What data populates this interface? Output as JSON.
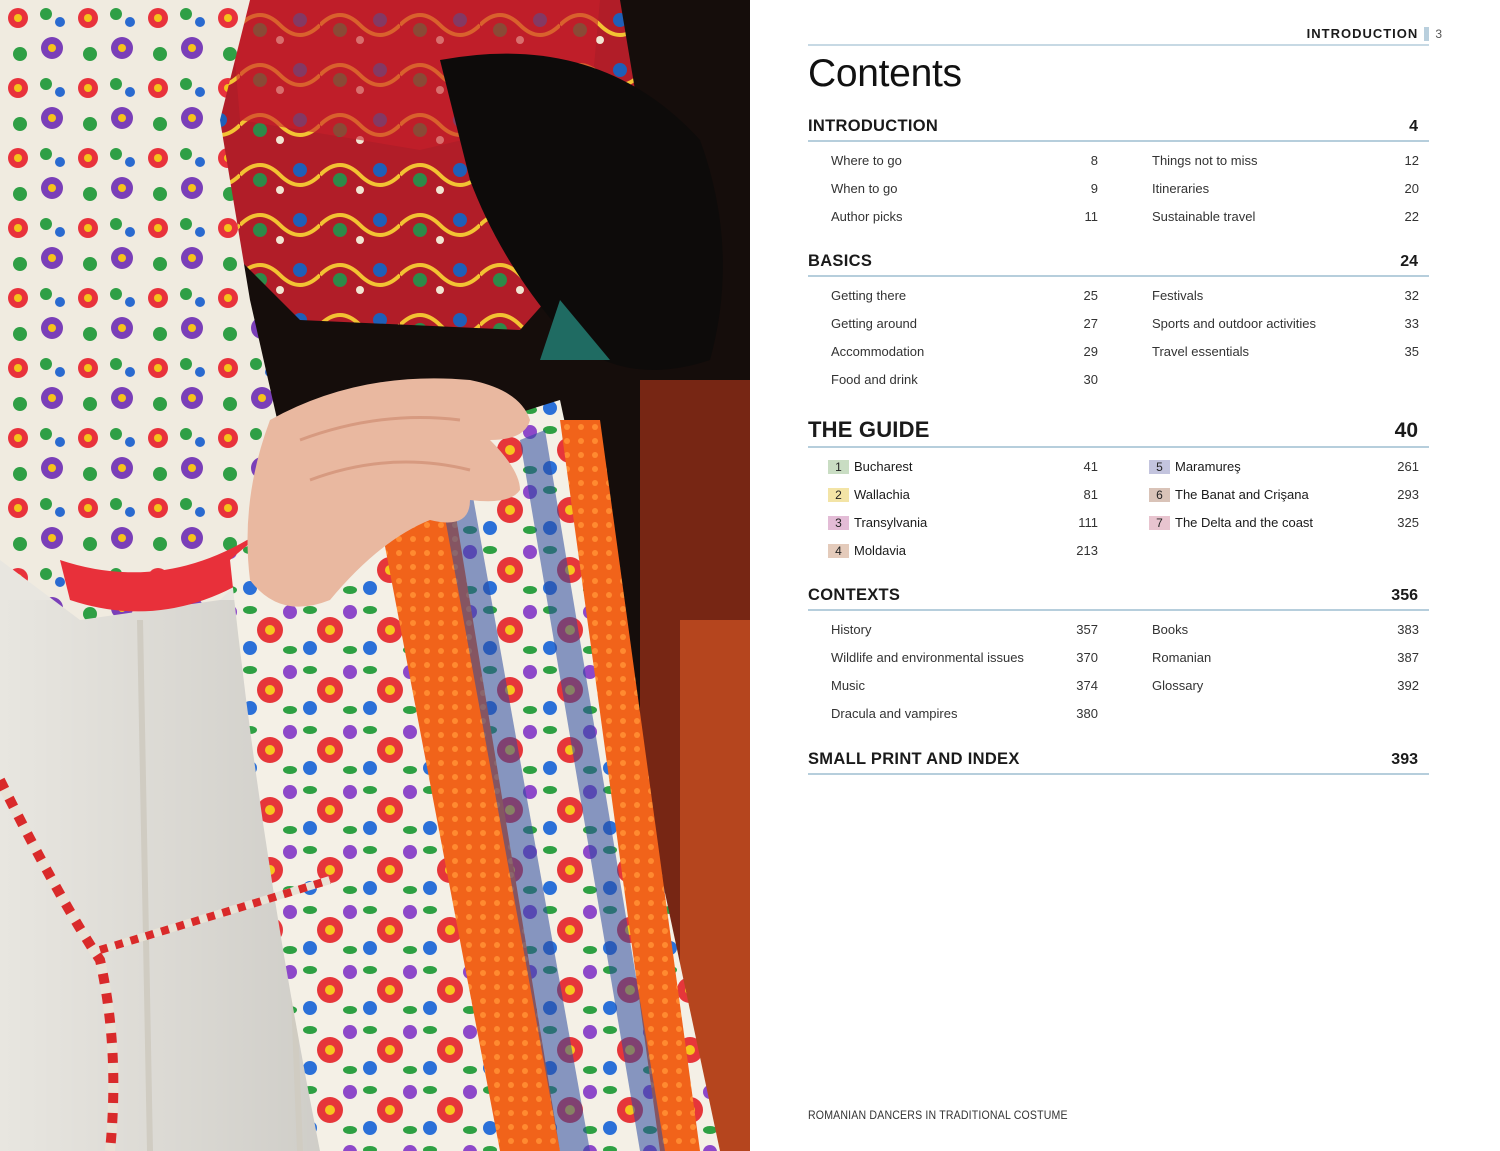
{
  "running_head": {
    "label": "INTRODUCTION",
    "page_number": "3"
  },
  "title": "Contents",
  "sections": {
    "introduction": {
      "title": "INTRODUCTION",
      "page": "4",
      "left": [
        {
          "label": "Where to go",
          "page": "8"
        },
        {
          "label": "When to go",
          "page": "9"
        },
        {
          "label": "Author picks",
          "page": "11"
        }
      ],
      "right": [
        {
          "label": "Things not to miss",
          "page": "12"
        },
        {
          "label": "Itineraries",
          "page": "20"
        },
        {
          "label": "Sustainable travel",
          "page": "22"
        }
      ]
    },
    "basics": {
      "title": "BASICS",
      "page": "24",
      "left": [
        {
          "label": "Getting there",
          "page": "25"
        },
        {
          "label": "Getting around",
          "page": "27"
        },
        {
          "label": "Accommodation",
          "page": "29"
        },
        {
          "label": "Food and drink",
          "page": "30"
        }
      ],
      "right": [
        {
          "label": "Festivals",
          "page": "32"
        },
        {
          "label": "Sports and outdoor activities",
          "page": "33"
        },
        {
          "label": "Travel essentials",
          "page": "35"
        }
      ]
    },
    "guide": {
      "title": "THE GUIDE",
      "page": "40",
      "left": [
        {
          "num": "1",
          "label": "Bucharest",
          "page": "41",
          "color": "#c9ddc3"
        },
        {
          "num": "2",
          "label": "Wallachia",
          "page": "81",
          "color": "#f3e4a6"
        },
        {
          "num": "3",
          "label": "Transylvania",
          "page": "111",
          "color": "#e3bcd6"
        },
        {
          "num": "4",
          "label": "Moldavia",
          "page": "213",
          "color": "#e4cbbb"
        }
      ],
      "right": [
        {
          "num": "5",
          "label": "Maramureş",
          "page": "261",
          "color": "#c3c4de"
        },
        {
          "num": "6",
          "label": "The Banat and Crişana",
          "page": "293",
          "color": "#d9c3b8"
        },
        {
          "num": "7",
          "label": "The Delta and the coast",
          "page": "325",
          "color": "#e8c4cf"
        }
      ]
    },
    "contexts": {
      "title": "CONTEXTS",
      "page": "356",
      "left": [
        {
          "label": "History",
          "page": "357"
        },
        {
          "label": "Wildlife and environmental issues",
          "page": "370"
        },
        {
          "label": "Music",
          "page": "374"
        },
        {
          "label": "Dracula and vampires",
          "page": "380"
        }
      ],
      "right": [
        {
          "label": "Books",
          "page": "383"
        },
        {
          "label": "Romanian",
          "page": "387"
        },
        {
          "label": "Glossary",
          "page": "392"
        }
      ]
    },
    "small_print": {
      "title": "SMALL PRINT AND INDEX",
      "page": "393"
    }
  },
  "caption": "ROMANIAN DANCERS IN TRADITIONAL COSTUME",
  "photo": {
    "subject": "embroidered-costume-photo"
  }
}
